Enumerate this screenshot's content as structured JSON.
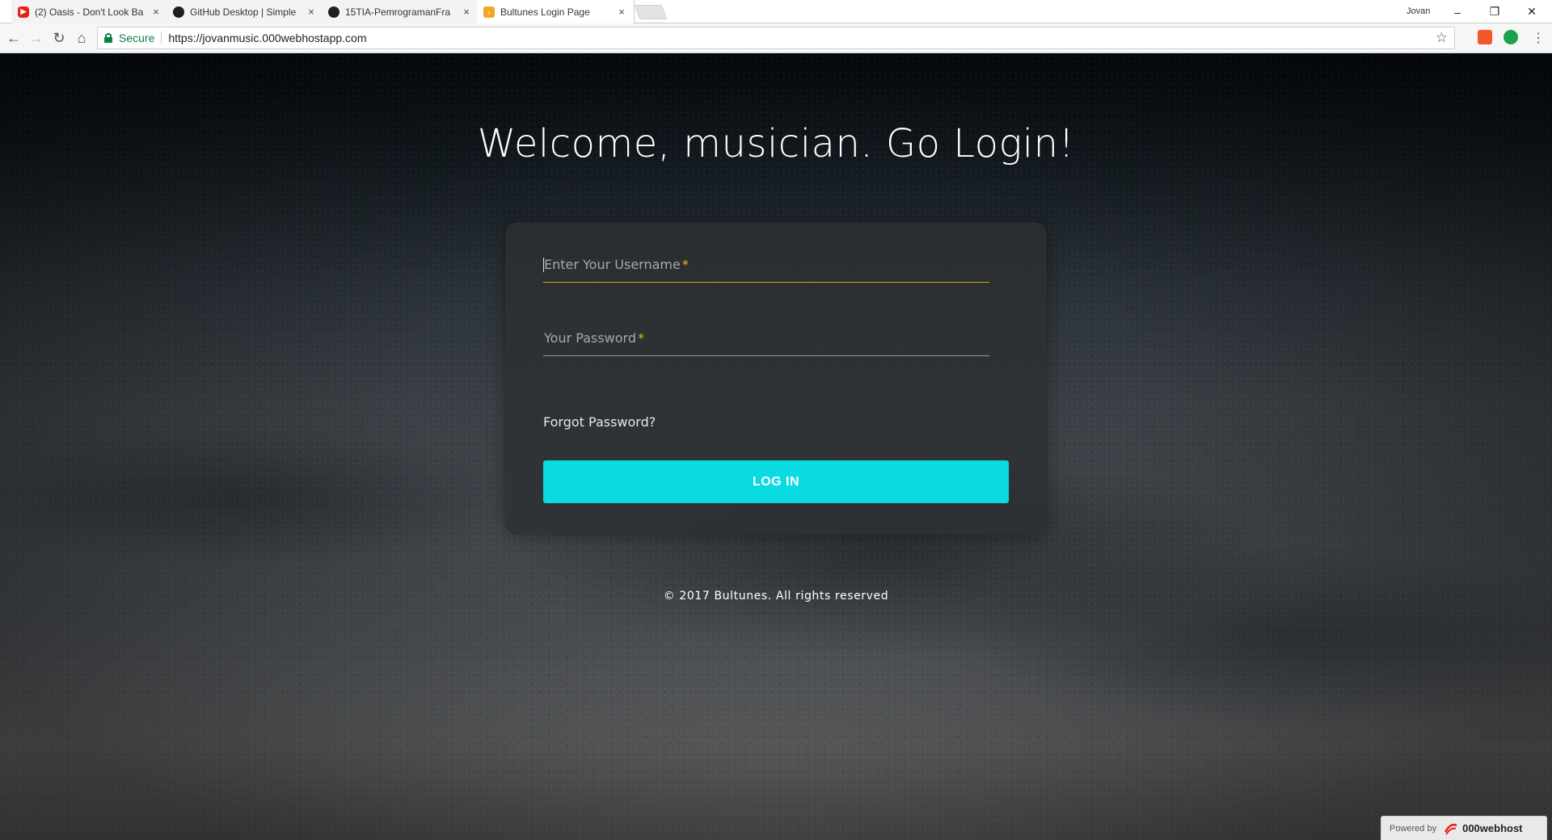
{
  "browser": {
    "tabs": [
      {
        "title": "(2) Oasis - Don't Look Ba",
        "favicon": "youtube-icon"
      },
      {
        "title": "GitHub Desktop | Simple",
        "favicon": "github-icon"
      },
      {
        "title": "15TIA-PemrogramanFra",
        "favicon": "github-icon"
      },
      {
        "title": "Bultunes Login Page",
        "favicon": "bultunes-icon"
      }
    ],
    "tab_close": "×",
    "profile_name": "Jovan",
    "window_controls": {
      "minimize": "–",
      "restore": "❐",
      "close": "✕"
    },
    "nav": {
      "back": "←",
      "forward": "→",
      "reload": "↻",
      "home": "⌂"
    },
    "secure_label": "Secure",
    "url": "https://jovanmusic.000webhostapp.com",
    "star": "☆"
  },
  "page": {
    "welcome": "Welcome, musician. Go Login!",
    "username_placeholder": "Enter Your Username",
    "password_placeholder": "Your Password",
    "required_mark": "*",
    "forgot_password": "Forgot Password?",
    "login_button": "LOG IN",
    "footer": "© 2017 Bultunes. All rights reserved",
    "powered_by_label": "Powered by",
    "powered_by_brand": "000webhost"
  },
  "colors": {
    "accent_button": "#0adbe0",
    "required_star": "#f0b429",
    "focus_underline": "#d9a825",
    "secure_green": "#0b8043"
  }
}
